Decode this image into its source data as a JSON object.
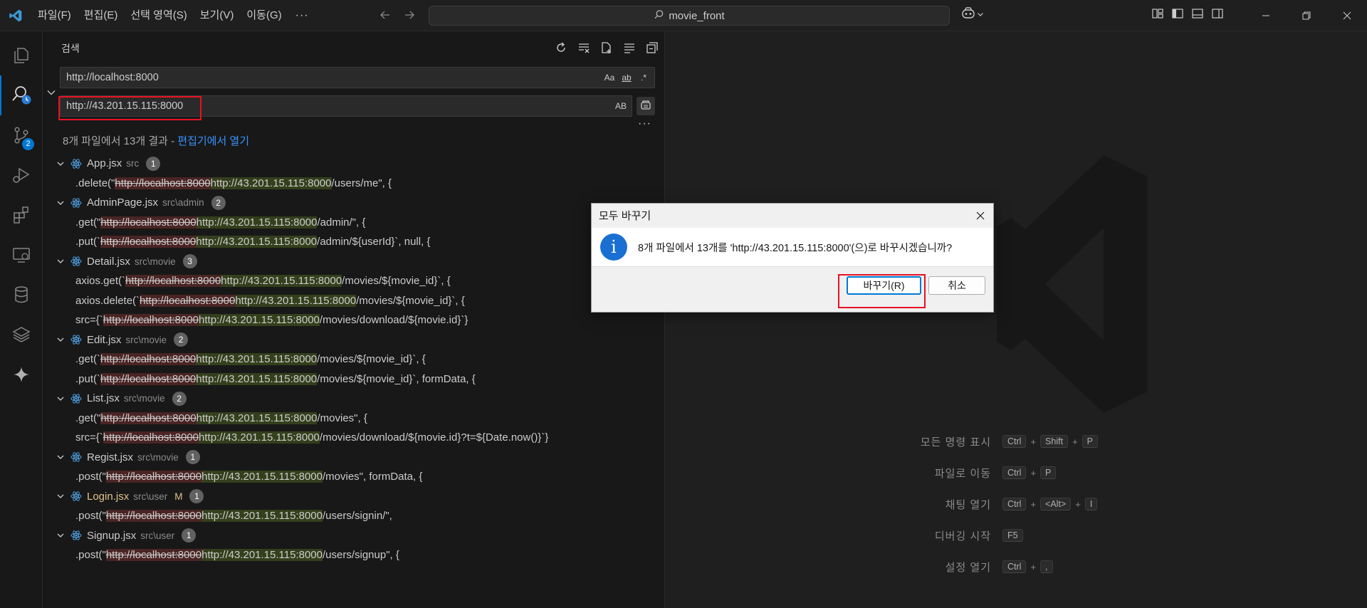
{
  "titlebar": {
    "menus": [
      "파일(F)",
      "편집(E)",
      "선택 영역(S)",
      "보기(V)",
      "이동(G)"
    ],
    "more": "···",
    "command_center": "movie_front"
  },
  "activity_bar": {
    "source_control_badge": "2"
  },
  "search": {
    "title": "검색",
    "find_value": "http://localhost:8000",
    "find_options": [
      "Aa",
      "ab",
      ".*"
    ],
    "replace_value": "http://43.201.15.115:8000",
    "replace_option": "AB",
    "more": "···",
    "summary_text": "8개 파일에서 13개 결과 - ",
    "summary_link": "편집기에서 열기"
  },
  "results": [
    {
      "file": "App.jsx",
      "path": "src",
      "modified": "",
      "count": "1",
      "matches": [
        {
          "pre": ".delete(\"",
          "old": "http://localhost:8000",
          "new": "http://43.201.15.115:8000",
          "post": "/users/me\", {"
        }
      ]
    },
    {
      "file": "AdminPage.jsx",
      "path": "src\\admin",
      "modified": "",
      "count": "2",
      "matches": [
        {
          "pre": ".get(\"",
          "old": "http://localhost:8000",
          "new": "http://43.201.15.115:8000",
          "post": "/admin/\", {"
        },
        {
          "pre": ".put(`",
          "old": "http://localhost:8000",
          "new": "http://43.201.15.115:8000",
          "post": "/admin/${userId}`, null, {"
        }
      ]
    },
    {
      "file": "Detail.jsx",
      "path": "src\\movie",
      "modified": "",
      "count": "3",
      "matches": [
        {
          "pre": "axios.get(`",
          "old": "http://localhost:8000",
          "new": "http://43.201.15.115:8000",
          "post": "/movies/${movie_id}`, {"
        },
        {
          "pre": "axios.delete(`",
          "old": "http://localhost:8000",
          "new": "http://43.201.15.115:8000",
          "post": "/movies/${movie_id}`, {"
        },
        {
          "pre": "src={`",
          "old": "http://localhost:8000",
          "new": "http://43.201.15.115:8000",
          "post": "/movies/download/${movie.id}`}"
        }
      ]
    },
    {
      "file": "Edit.jsx",
      "path": "src\\movie",
      "modified": "",
      "count": "2",
      "matches": [
        {
          "pre": ".get(`",
          "old": "http://localhost:8000",
          "new": "http://43.201.15.115:8000",
          "post": "/movies/${movie_id}`, {"
        },
        {
          "pre": ".put(`",
          "old": "http://localhost:8000",
          "new": "http://43.201.15.115:8000",
          "post": "/movies/${movie_id}`, formData, {"
        }
      ]
    },
    {
      "file": "List.jsx",
      "path": "src\\movie",
      "modified": "",
      "count": "2",
      "matches": [
        {
          "pre": ".get(\"",
          "old": "http://localhost:8000",
          "new": "http://43.201.15.115:8000",
          "post": "/movies\", {"
        },
        {
          "pre": "src={`",
          "old": "http://localhost:8000",
          "new": "http://43.201.15.115:8000",
          "post": "/movies/download/${movie.id}?t=${Date.now()}`}"
        }
      ]
    },
    {
      "file": "Regist.jsx",
      "path": "src\\movie",
      "modified": "",
      "count": "1",
      "matches": [
        {
          "pre": ".post(\"",
          "old": "http://localhost:8000",
          "new": "http://43.201.15.115:8000",
          "post": "/movies\", formData, {"
        }
      ]
    },
    {
      "file": "Login.jsx",
      "path": "src\\user",
      "modified": "M",
      "count": "1",
      "matches": [
        {
          "pre": ".post(\"",
          "old": "http://localhost:8000",
          "new": "http://43.201.15.115:8000",
          "post": "/users/signin/\","
        }
      ]
    },
    {
      "file": "Signup.jsx",
      "path": "src\\user",
      "modified": "",
      "count": "1",
      "matches": [
        {
          "pre": ".post(\"",
          "old": "http://localhost:8000",
          "new": "http://43.201.15.115:8000",
          "post": "/users/signup\", {"
        }
      ]
    }
  ],
  "shortcuts": [
    {
      "label": "모든 명령 표시",
      "keys": [
        "Ctrl",
        "Shift",
        "P"
      ]
    },
    {
      "label": "파일로 이동",
      "keys": [
        "Ctrl",
        "P"
      ]
    },
    {
      "label": "채팅 열기",
      "keys": [
        "Ctrl",
        "<Alt>",
        "I"
      ]
    },
    {
      "label": "디버깅 시작",
      "keys": [
        "F5"
      ]
    },
    {
      "label": "설정 열기",
      "keys": [
        "Ctrl",
        ","
      ]
    }
  ],
  "dialog": {
    "title": "모두 바꾸기",
    "message": "8개 파일에서 13개를 'http://43.201.15.115:8000'(으)로 바꾸시겠습니까?",
    "confirm_label": "바꾸기(R)",
    "cancel_label": "취소",
    "info_glyph": "i"
  },
  "colors": {
    "accent": "#0078d4",
    "removed_bg": "#5a2a2a",
    "added_bg": "#3b4a1f",
    "highlight": "#e81123"
  }
}
